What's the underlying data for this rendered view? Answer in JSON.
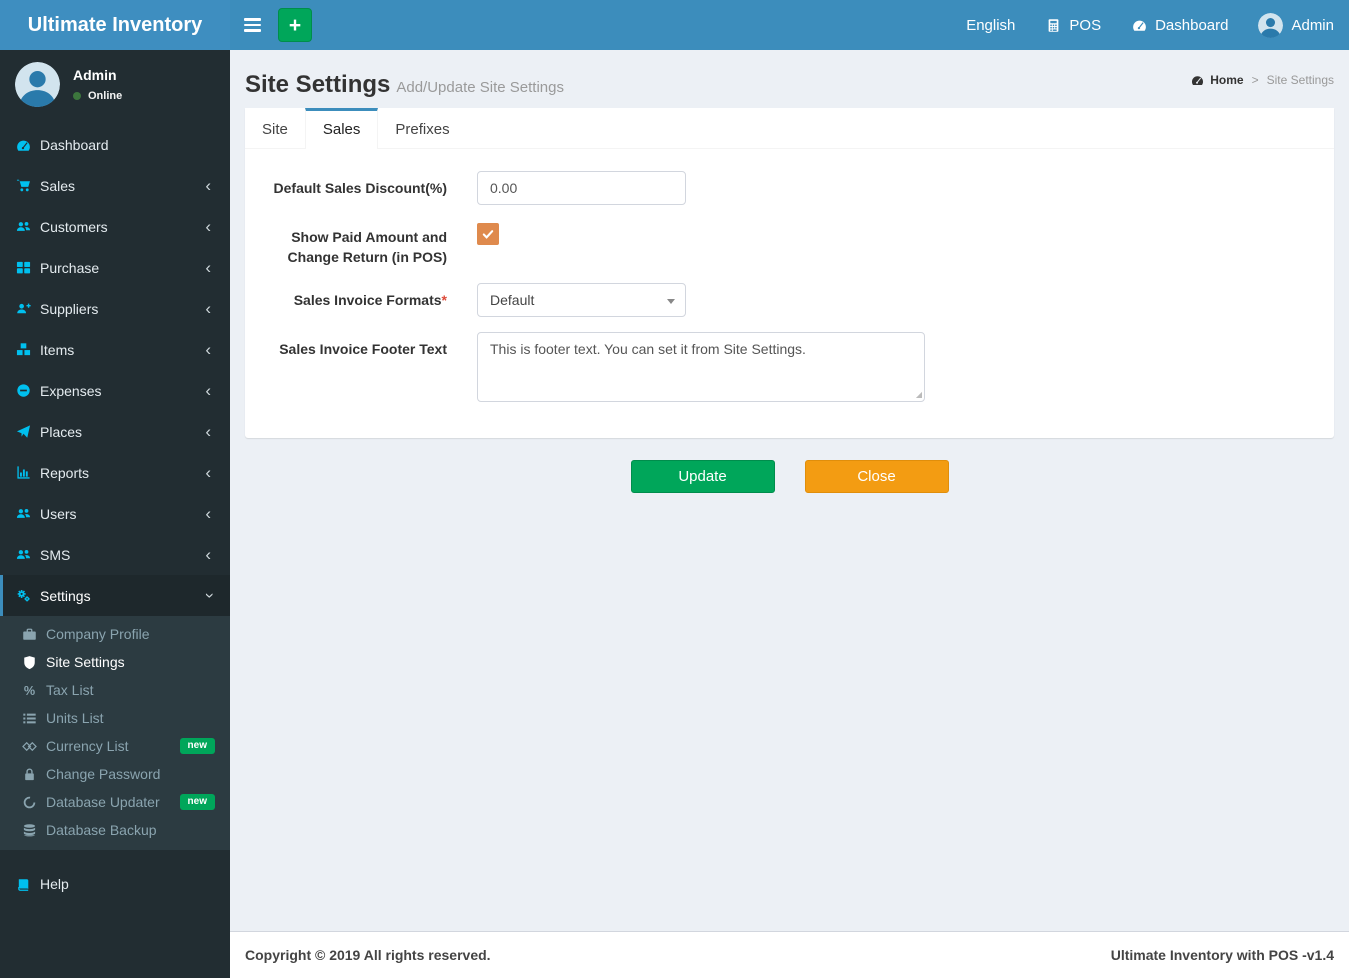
{
  "app": {
    "title": "Ultimate Inventory",
    "footer_left": "Copyright © 2019 All rights reserved.",
    "footer_right": "Ultimate Inventory with POS -v1.4"
  },
  "colors": {
    "navbar_blue": "#3c8dbc",
    "sidebar_dark": "#222d32",
    "submenu_dark": "#2c3b41",
    "icon_cyan": "#00c0ef",
    "success_green": "#00a65a",
    "warning_orange": "#f39c12",
    "checkbox_orange": "#df8a4d",
    "content_bg": "#ecf0f5",
    "online_green": "#3c763d",
    "required_red": "#dd4b39"
  },
  "navbar": {
    "items": [
      {
        "label": "English",
        "icon": null
      },
      {
        "label": "POS",
        "icon": "calculator"
      },
      {
        "label": "Dashboard",
        "icon": "speedometer"
      },
      {
        "label": "Admin",
        "icon": "user-avatar"
      }
    ]
  },
  "sidebar": {
    "user": {
      "name": "Admin",
      "status": "Online"
    },
    "items": [
      {
        "label": "Dashboard",
        "icon": "speedometer"
      },
      {
        "label": "Sales",
        "icon": "cart",
        "chevron": true
      },
      {
        "label": "Customers",
        "icon": "users",
        "chevron": true
      },
      {
        "label": "Purchase",
        "icon": "grid",
        "chevron": true
      },
      {
        "label": "Suppliers",
        "icon": "user-plus",
        "chevron": true
      },
      {
        "label": "Items",
        "icon": "cubes",
        "chevron": true
      },
      {
        "label": "Expenses",
        "icon": "minus-circle",
        "chevron": true
      },
      {
        "label": "Places",
        "icon": "send",
        "chevron": true
      },
      {
        "label": "Reports",
        "icon": "chart",
        "chevron": true
      },
      {
        "label": "Users",
        "icon": "users",
        "chevron": true
      },
      {
        "label": "SMS",
        "icon": "users",
        "chevron": true
      },
      {
        "label": "Settings",
        "icon": "gears",
        "chevron": true,
        "active": true,
        "expanded": true,
        "children": [
          {
            "label": "Company Profile",
            "icon": "briefcase"
          },
          {
            "label": "Site Settings",
            "icon": "shield",
            "active": true
          },
          {
            "label": "Tax List",
            "icon": "percent"
          },
          {
            "label": "Units List",
            "icon": "list"
          },
          {
            "label": "Currency List",
            "icon": "diamonds",
            "badge": "new"
          },
          {
            "label": "Change Password",
            "icon": "lock"
          },
          {
            "label": "Database Updater",
            "icon": "circle-notch",
            "badge": "new"
          },
          {
            "label": "Database Backup",
            "icon": "database"
          }
        ]
      },
      {
        "label": "Help",
        "icon": "book"
      }
    ]
  },
  "page": {
    "title": "Site Settings",
    "subtitle": "Add/Update Site Settings",
    "breadcrumb": {
      "home": "Home",
      "current": "Site Settings",
      "separator": ">"
    },
    "tabs": [
      {
        "label": "Site"
      },
      {
        "label": "Sales",
        "active": true
      },
      {
        "label": "Prefixes"
      }
    ],
    "form": {
      "discount_label": "Default Sales Discount(%)",
      "discount_value": "0.00",
      "paid_amount_label": "Show Paid Amount and Change Return (in POS)",
      "paid_amount_checked": true,
      "invoice_format_label": "Sales Invoice Formats",
      "invoice_format_required": "*",
      "invoice_format_value": "Default",
      "footer_text_label": "Sales Invoice Footer Text",
      "footer_text_value": "This is footer text. You can set it from Site Settings."
    },
    "buttons": {
      "update": "Update",
      "close": "Close"
    }
  }
}
